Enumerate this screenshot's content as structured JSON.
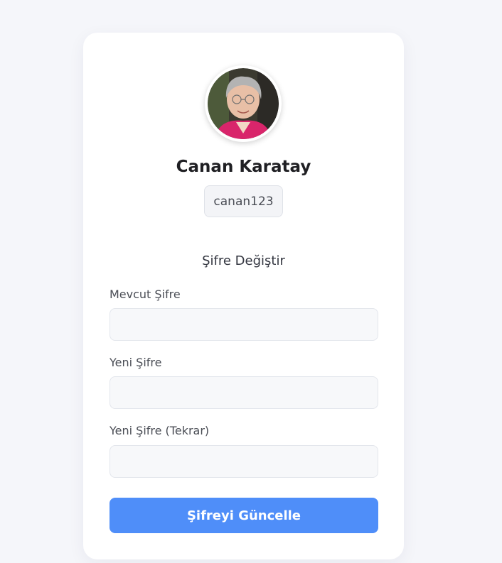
{
  "profile": {
    "name": "Canan Karatay",
    "username": "canan123"
  },
  "password_form": {
    "title": "Şifre Değiştir",
    "current_password": {
      "label": "Mevcut Şifre",
      "value": ""
    },
    "new_password": {
      "label": "Yeni Şifre",
      "value": ""
    },
    "confirm_password": {
      "label": "Yeni Şifre (Tekrar)",
      "value": ""
    },
    "submit_label": "Şifreyi Güncelle"
  },
  "colors": {
    "background": "#f5f6fa",
    "card": "#ffffff",
    "accent": "#4f8ef9",
    "input_bg": "#f7f8fa"
  }
}
